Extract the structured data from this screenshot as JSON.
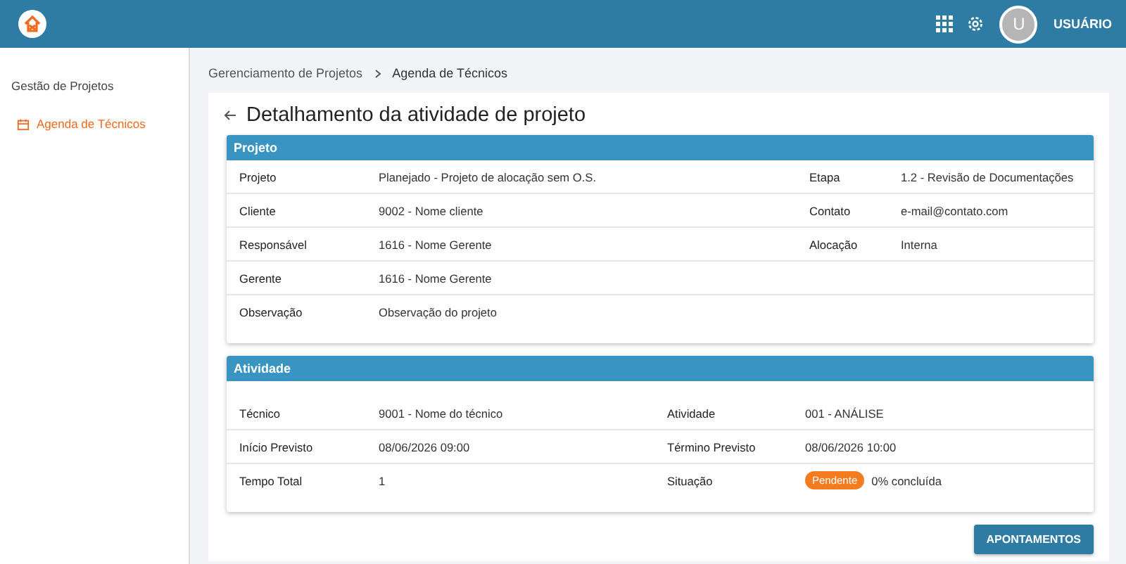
{
  "header": {
    "avatar_letter": "U",
    "user": "USUÁRIO"
  },
  "sidebar": {
    "group": "Gestão de Projetos",
    "items": [
      {
        "label": "Agenda de Técnicos",
        "selected": true
      }
    ]
  },
  "breadcrumb": [
    "Gerenciamento de Projetos",
    "Agenda de Técnicos"
  ],
  "page_title": "Detalhamento da atividade de projeto",
  "sections": [
    {
      "title": "Projeto",
      "rows": [
        [
          {
            "label": "Projeto",
            "value": "Planejado - Projeto de alocação sem O.S."
          },
          {
            "label": "Etapa",
            "value": "1.2 - Revisão de Documentações"
          }
        ],
        [
          {
            "label": "Cliente",
            "value": "9002 - Nome cliente"
          },
          {
            "label": "Contato",
            "value": "e-mail@contato.com"
          }
        ],
        [
          {
            "label": "Responsável",
            "value": "1616 - Nome Gerente"
          },
          {
            "label": "Alocação",
            "value": "Interna"
          }
        ],
        [
          {
            "label": "Gerente",
            "value": "1616 - Nome Gerente"
          }
        ],
        [
          {
            "label": "Observação",
            "value": "Observação do projeto"
          }
        ]
      ]
    },
    {
      "title": "Atividade",
      "rows": [
        [
          {
            "label": "Técnico",
            "value": "9001 - Nome do técnico"
          },
          {
            "label": "Atividade",
            "value": "001 - ANÁLISE"
          }
        ],
        [
          {
            "label": "Início Previsto",
            "value": "08/06/2026 09:00"
          },
          {
            "label": "Término Previsto",
            "value": "08/06/2026 10:00"
          }
        ],
        [
          {
            "label": "Tempo Total",
            "value": "1"
          },
          {
            "label": "Situação",
            "badge": "Pendente",
            "value": "0% concluída"
          }
        ]
      ]
    }
  ],
  "button": "APONTAMENTOS"
}
